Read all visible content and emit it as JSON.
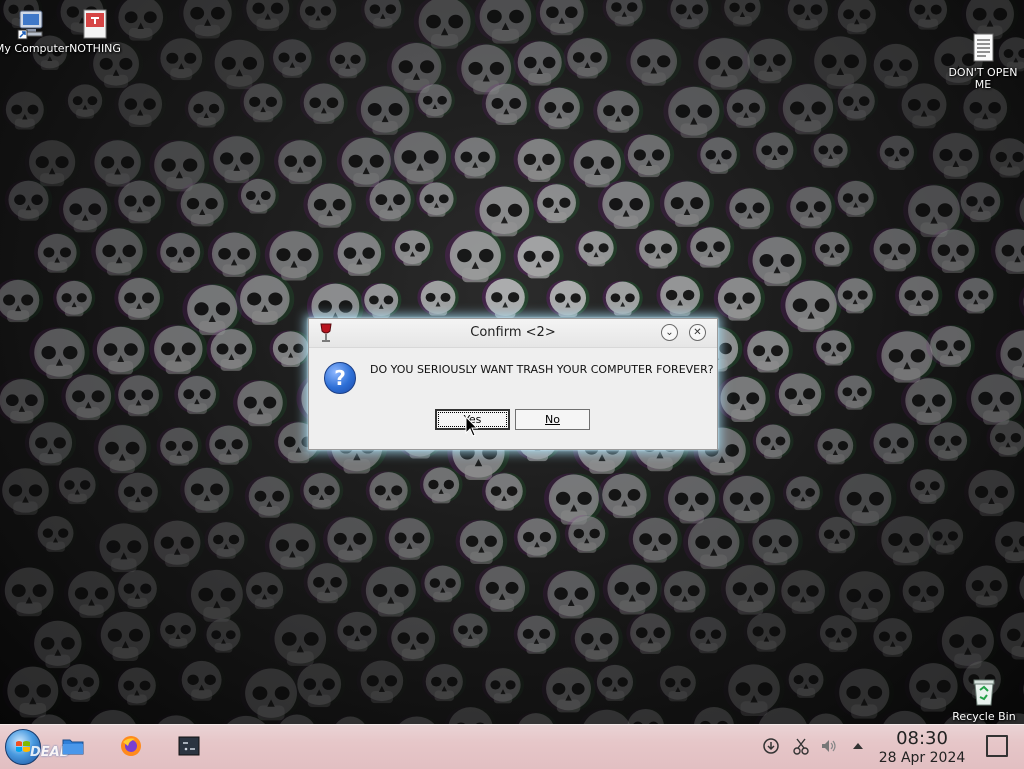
{
  "desktop": {
    "icons": [
      {
        "label": "My Computer",
        "icon": "my-computer-icon"
      },
      {
        "label": "NOTHING",
        "icon": "document-icon"
      },
      {
        "label": "DON'T OPEN\nME",
        "icon": "text-file-icon"
      },
      {
        "label": "Recycle Bin",
        "icon": "recycle-bin-icon"
      }
    ]
  },
  "dialog": {
    "title": "Confirm <2>",
    "message": "DO YOU SERIOUSLY WANT TRASH YOUR COMPUTER FOREVER?",
    "yes_label": "Yes",
    "no_label": "No",
    "question_glyph": "?"
  },
  "taskbar": {
    "start_label": "DEAD",
    "clock_time": "08:30",
    "clock_date": "28 Apr 2024",
    "pinned": [
      "file-manager-icon",
      "firefox-icon",
      "terminal-icon"
    ],
    "tray": [
      "network-icon",
      "scissors-icon",
      "volume-icon",
      "chevron-up-icon"
    ]
  },
  "colors": {
    "taskbar": "#e6c6c8",
    "dialog_glow": "#aae6ff",
    "question_icon": "#2d6fd6"
  }
}
